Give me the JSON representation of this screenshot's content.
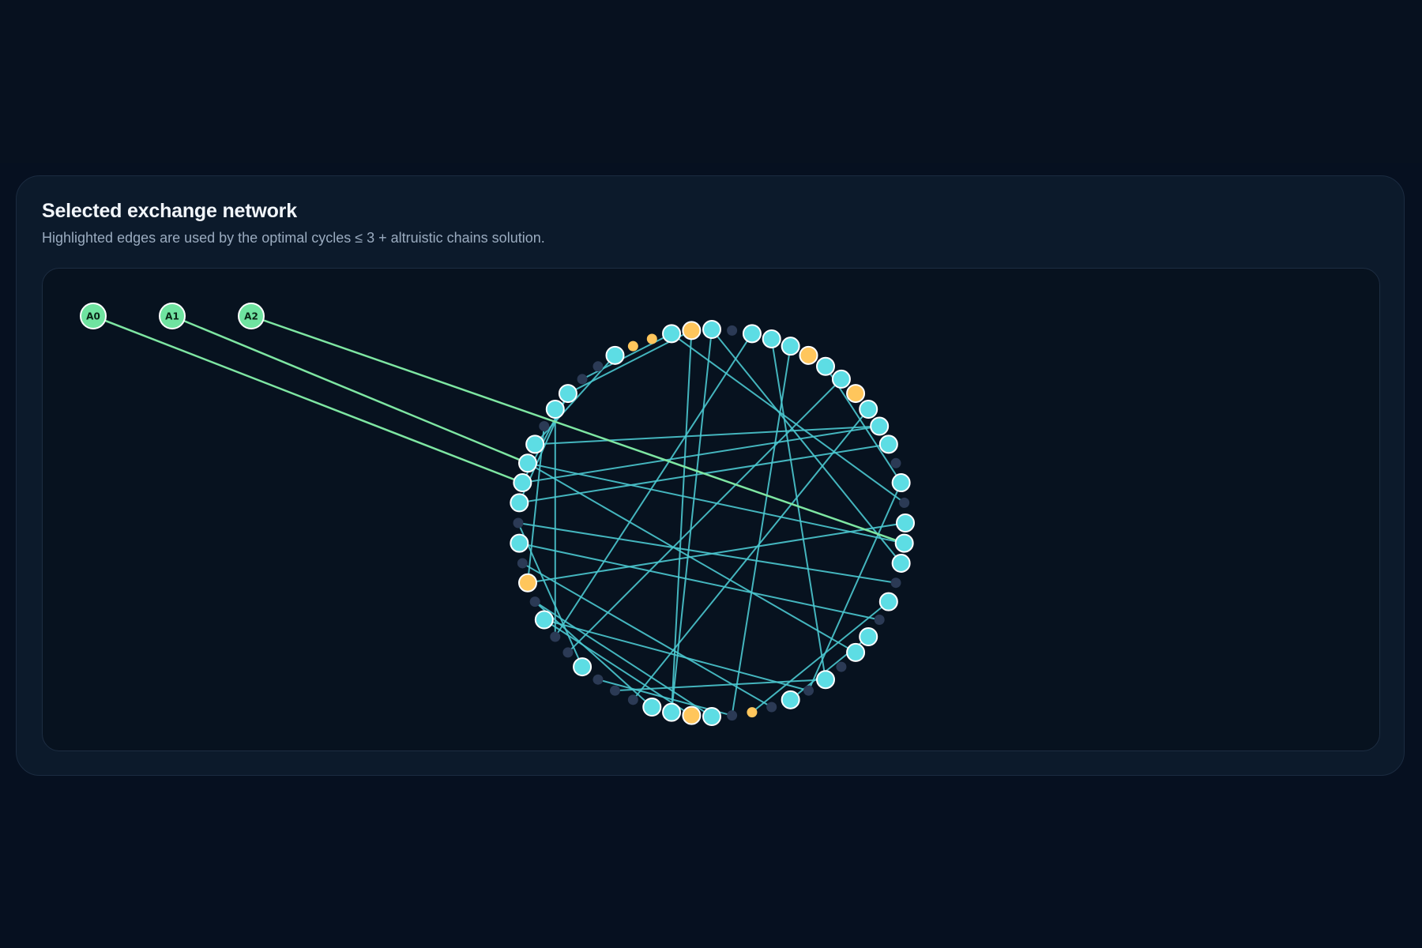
{
  "header": {
    "title": "Selected exchange network",
    "subtitle": "Highlighted edges are used by the optimal cycles ≤ 3 + altruistic chains solution."
  },
  "colors": {
    "altruist": "#6fe3a0",
    "pair_matched": "#5ddde4",
    "pair_highlighted": "#ffc65c",
    "pair_unmatched": "#2b3a55",
    "edge_cycle": "#4bc8cf",
    "edge_chain": "#7ee6a2",
    "node_stroke": "#ffffff"
  },
  "network": {
    "ring_node_count": 60,
    "altruists": [
      {
        "label": "A0"
      },
      {
        "label": "A1"
      },
      {
        "label": "A2"
      }
    ],
    "node_states": [
      "matched",
      "unmatched",
      "matched",
      "matched",
      "matched",
      "highlighted",
      "matched",
      "matched",
      "highlighted",
      "matched",
      "matched",
      "matched",
      "unmatched",
      "matched",
      "unmatched",
      "matched",
      "matched",
      "matched",
      "unmatched",
      "matched",
      "unmatched",
      "matched",
      "matched",
      "unmatched",
      "matched",
      "unmatched",
      "matched",
      "unmatched",
      "highlighted-small",
      "unmatched",
      "matched",
      "highlighted",
      "matched",
      "matched",
      "unmatched",
      "unmatched",
      "unmatched",
      "matched",
      "unmatched",
      "unmatched",
      "matched",
      "unmatched",
      "highlighted",
      "unmatched",
      "matched",
      "unmatched",
      "matched",
      "matched",
      "matched",
      "matched",
      "unmatched",
      "matched",
      "matched",
      "unmatched",
      "unmatched",
      "matched",
      "highlighted-small",
      "highlighted-small",
      "matched",
      "highlighted"
    ],
    "cycle_edges": [
      [
        0,
        17
      ],
      [
        0,
        32
      ],
      [
        2,
        39
      ],
      [
        3,
        24
      ],
      [
        4,
        29
      ],
      [
        6,
        13
      ],
      [
        7,
        38
      ],
      [
        9,
        34
      ],
      [
        10,
        47
      ],
      [
        10,
        49
      ],
      [
        11,
        46
      ],
      [
        13,
        25
      ],
      [
        14,
        58
      ],
      [
        15,
        42
      ],
      [
        16,
        48
      ],
      [
        18,
        45
      ],
      [
        19,
        28
      ],
      [
        20,
        44
      ],
      [
        21,
        26
      ],
      [
        22,
        48
      ],
      [
        24,
        35
      ],
      [
        25,
        40
      ],
      [
        27,
        43
      ],
      [
        29,
        36
      ],
      [
        30,
        41
      ],
      [
        31,
        40
      ],
      [
        32,
        59
      ],
      [
        33,
        41
      ],
      [
        37,
        45
      ],
      [
        39,
        51
      ],
      [
        42,
        50
      ],
      [
        46,
        52
      ],
      [
        47,
        52
      ],
      [
        49,
        55
      ],
      [
        52,
        59
      ],
      [
        53,
        58
      ]
    ],
    "chain_edges": [
      [
        "A0",
        47
      ],
      [
        "A1",
        48
      ],
      [
        "A2",
        16
      ]
    ]
  }
}
